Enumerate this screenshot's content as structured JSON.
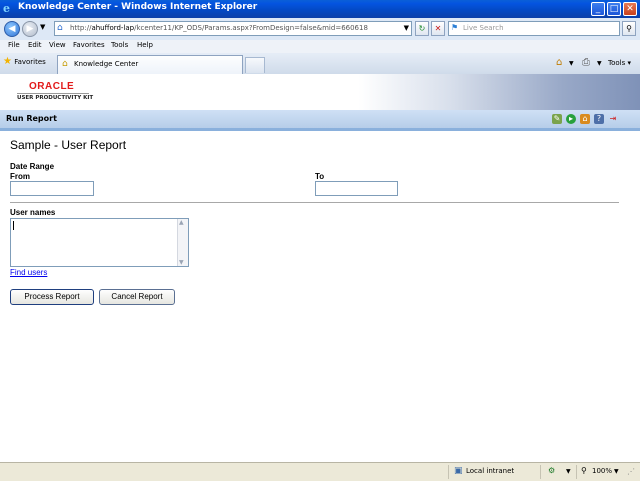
{
  "window": {
    "title": "Knowledge Center - Windows Internet Explorer",
    "minimize": "_",
    "maximize": "□",
    "close": "✕"
  },
  "address": {
    "url_prefix": "http://",
    "url_host": "ahufford-lap",
    "url_rest": "/kcenter11/KP_ODS/Params.aspx?FromDesign=false&mid=660618",
    "search_placeholder": "Live Search"
  },
  "menu": [
    "File",
    "Edit",
    "View",
    "Favorites",
    "Tools",
    "Help"
  ],
  "favorites": {
    "label": "Favorites"
  },
  "tab": {
    "label": "Knowledge Center"
  },
  "toolbar": {
    "tools_label": "Tools"
  },
  "page": {
    "logo": "ORACLE",
    "logo_sub": "USER PRODUCTIVITY KIT",
    "header": "Run Report",
    "title": "Sample - User Report",
    "date_range_label": "Date Range",
    "from_label": "From",
    "from_value": "",
    "to_label": "To",
    "to_value": "",
    "user_names_label": "User names",
    "user_names_value": "",
    "find_users_link": "Find users",
    "process_button": "Process Report",
    "cancel_button": "Cancel Report"
  },
  "status": {
    "zone": "Local intranet",
    "zoom": "100%"
  },
  "colors": {
    "titlebar": "#0454e0",
    "header_band": "#b6cde9",
    "link": "#0000ee",
    "oracle_red": "#e21a1a"
  }
}
